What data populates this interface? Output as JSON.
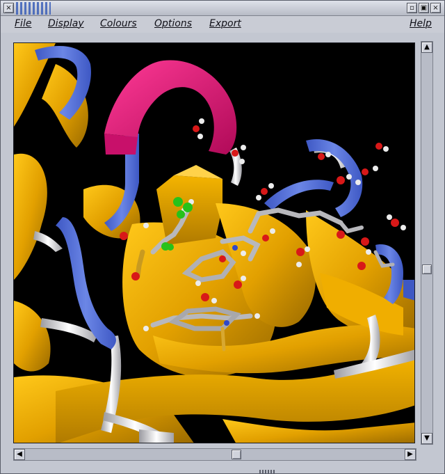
{
  "window": {
    "close_glyph": "×",
    "minimize_glyph": "▫",
    "maximize_glyph": "▣",
    "xclose_glyph": "×"
  },
  "menubar": {
    "items": [
      {
        "label": "File"
      },
      {
        "label": "Display"
      },
      {
        "label": "Colours"
      },
      {
        "label": "Options"
      },
      {
        "label": "Export"
      }
    ],
    "help_label": "Help"
  },
  "scrollbars": {
    "up_glyph": "▲",
    "down_glyph": "▼",
    "left_glyph": "◀",
    "right_glyph": "▶"
  },
  "colors": {
    "helix": "#e8157a",
    "strand": "#e6a800",
    "turn": "#5470d6",
    "coil": "#e8e8ea",
    "ligand_carbon": "#a8a8aa",
    "oxygen": "#d81818",
    "hydrogen": "#ececec",
    "chlorine": "#26c21a",
    "nitrogen": "#3048c8",
    "background": "#000000"
  }
}
